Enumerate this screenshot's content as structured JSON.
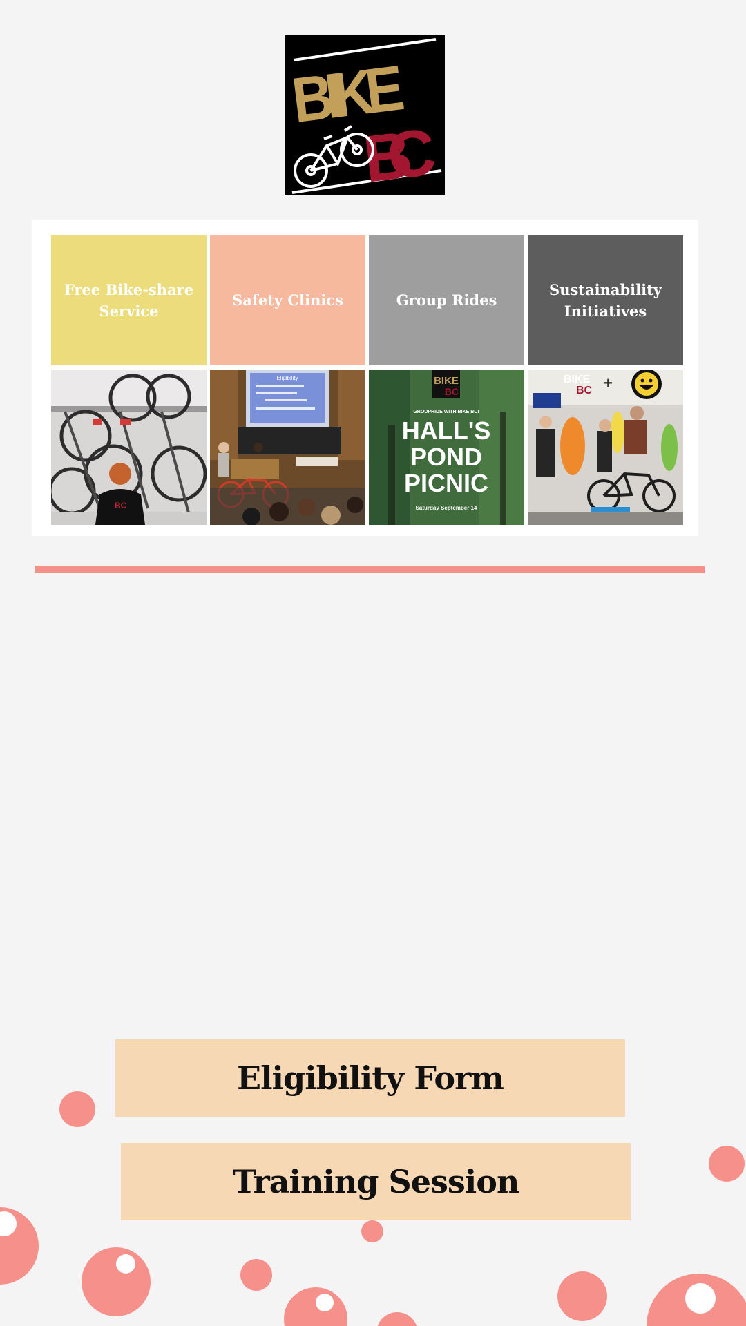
{
  "logo": {
    "line1": "BIKE",
    "line2": "BC",
    "icon": "bicycle-icon",
    "colors": {
      "gold": "#c2a05a",
      "red": "#a3162f",
      "background": "#000000"
    }
  },
  "programs": [
    {
      "label": "Free Bike-share Service",
      "color": "#ecdc7c"
    },
    {
      "label": "Safety Clinics",
      "color": "#f6b99d"
    },
    {
      "label": "Group Rides",
      "color": "#9e9e9e"
    },
    {
      "label": "Sustainability Initiatives",
      "color": "#5e5d5e"
    }
  ],
  "photos": {
    "bike_rack": {
      "shirt_text": "BC"
    },
    "safety_clinic": {
      "slide_title": "Eligibility"
    },
    "group_ride_poster": {
      "logo_line1": "BIKE",
      "logo_line2": "BC",
      "kicker": "GROUPRIDE WITH BIKE BC!",
      "headline_1": "HALL'S",
      "headline_2": "POND",
      "headline_3": "PICNIC",
      "date": "Saturday September 14"
    },
    "costume_event": {
      "logo_line1": "BIKE",
      "logo_line2": "BC",
      "plus": "+"
    }
  },
  "buttons": {
    "eligibility": "Eligibility Form",
    "training": "Training Session"
  },
  "colors": {
    "accent": "#f5918a",
    "button_bg": "#f7d8b5",
    "page_bg": "#f5f4f5"
  }
}
